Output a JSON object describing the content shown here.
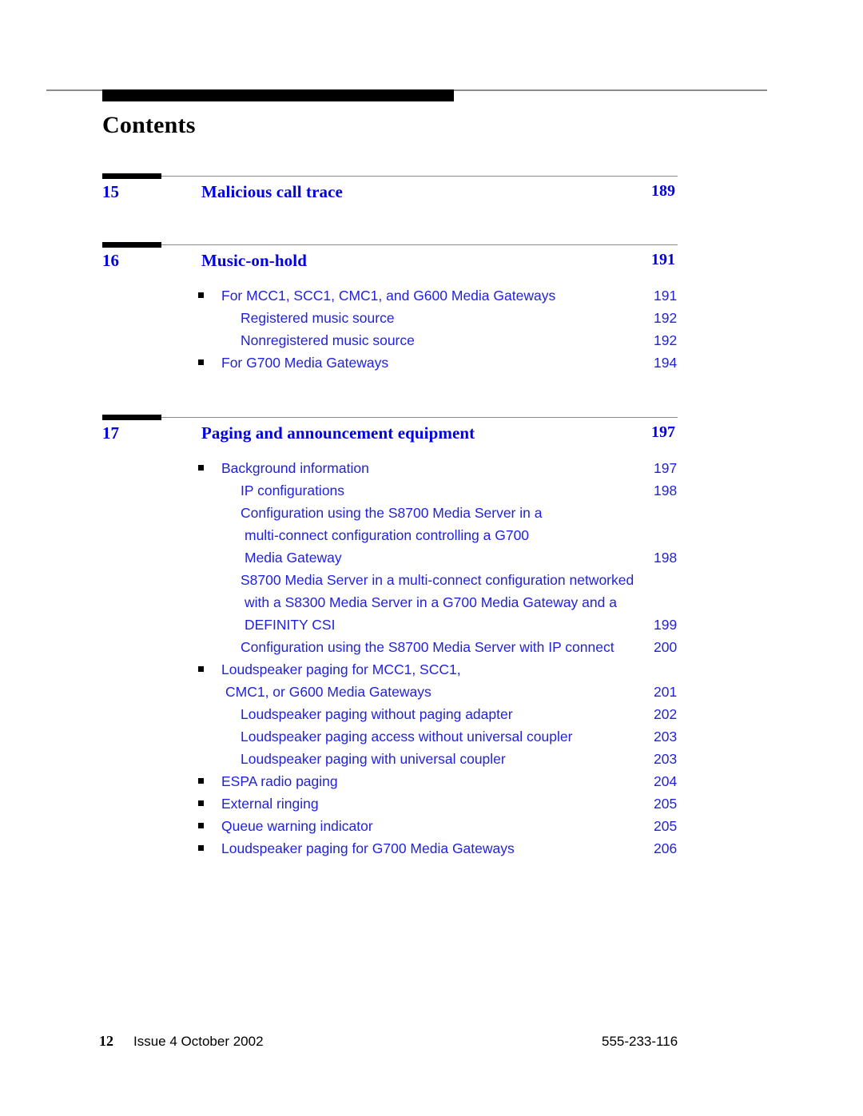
{
  "document": {
    "page_title": "Contents",
    "accent_color": "#0000e0",
    "entry_color": "#2222dd",
    "rule_color": "#8c8c8c",
    "bar_color": "#000000"
  },
  "chapters": [
    {
      "number": "15",
      "title": "Malicious call trace",
      "page": "189",
      "entries": []
    },
    {
      "number": "16",
      "title": "Music-on-hold",
      "page": "191",
      "entries": [
        {
          "level": 1,
          "bullet": true,
          "text": "For MCC1, SCC1, CMC1, and G600 Media Gateways",
          "page": "191"
        },
        {
          "level": 2,
          "bullet": false,
          "text": "Registered music source",
          "page": "192"
        },
        {
          "level": 2,
          "bullet": false,
          "text": "Nonregistered music source",
          "page": "192"
        },
        {
          "level": 1,
          "bullet": true,
          "text": "For G700 Media Gateways",
          "page": "194"
        }
      ]
    },
    {
      "number": "17",
      "title": "Paging and announcement equipment",
      "page": "197",
      "entries": [
        {
          "level": 1,
          "bullet": true,
          "text": "Background information",
          "page": "197"
        },
        {
          "level": 2,
          "bullet": false,
          "text": "IP configurations",
          "page": "198"
        },
        {
          "level": 2,
          "bullet": false,
          "text": "Configuration using the S8700 Media Server in a\nmulti-connect configuration controlling a G700\nMedia Gateway",
          "page": "198"
        },
        {
          "level": 2,
          "bullet": false,
          "text": "S8700 Media Server in a multi-connect configuration networked\nwith a S8300 Media Server in a G700 Media Gateway and a\nDEFINITY CSI",
          "page": "199"
        },
        {
          "level": 2,
          "bullet": false,
          "text": "Configuration using the S8700 Media Server with IP connect",
          "page": "200"
        },
        {
          "level": 1,
          "bullet": true,
          "text": "Loudspeaker paging for MCC1, SCC1,\nCMC1, or G600 Media Gateways",
          "page": "201"
        },
        {
          "level": 2,
          "bullet": false,
          "text": "Loudspeaker paging without paging adapter",
          "page": "202"
        },
        {
          "level": 2,
          "bullet": false,
          "text": "Loudspeaker paging access without universal coupler",
          "page": "203"
        },
        {
          "level": 2,
          "bullet": false,
          "text": "Loudspeaker paging with universal coupler",
          "page": "203"
        },
        {
          "level": 1,
          "bullet": true,
          "text": "ESPA radio paging",
          "page": "204"
        },
        {
          "level": 1,
          "bullet": true,
          "text": "External ringing",
          "page": "205"
        },
        {
          "level": 1,
          "bullet": true,
          "text": "Queue warning indicator",
          "page": "205"
        },
        {
          "level": 1,
          "bullet": true,
          "text": "Loudspeaker paging for G700 Media Gateways",
          "page": "206"
        }
      ]
    }
  ],
  "footer": {
    "page_number": "12",
    "issue": "Issue 4  October 2002",
    "doc_number": "555-233-116"
  }
}
